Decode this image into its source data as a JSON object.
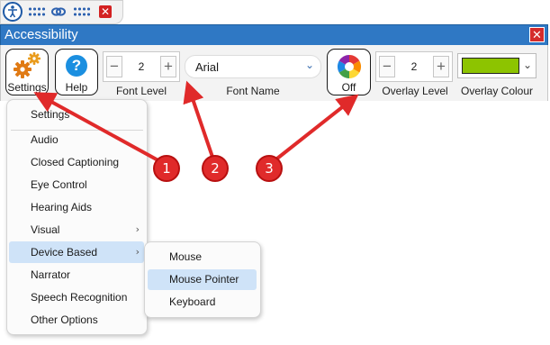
{
  "window": {
    "title": "Accessibility",
    "close_symbol": "✕"
  },
  "topbar": {
    "close_symbol": "✕"
  },
  "toolbar": {
    "settings_label": "Settings",
    "help_label": "Help",
    "help_symbol": "?",
    "font_level": {
      "label": "Font Level",
      "value": "2",
      "minus": "−",
      "plus": "+"
    },
    "font_name": {
      "label": "Font Name",
      "value": "Arial"
    },
    "overlay_toggle_label": "Off",
    "overlay_level": {
      "label": "Overlay Level",
      "value": "2",
      "minus": "−",
      "plus": "+"
    },
    "overlay_colour": {
      "label": "Overlay Colour",
      "color": "#8dc400"
    }
  },
  "settings_menu": {
    "items": [
      {
        "label": "Settings"
      },
      {
        "label": "Audio"
      },
      {
        "label": "Closed Captioning"
      },
      {
        "label": "Eye Control"
      },
      {
        "label": "Hearing Aids"
      },
      {
        "label": "Visual",
        "has_submenu": true
      },
      {
        "label": "Device Based",
        "has_submenu": true,
        "selected": true
      },
      {
        "label": "Narrator"
      },
      {
        "label": "Speech Recognition"
      },
      {
        "label": "Other Options"
      }
    ],
    "submenu_arrow": "›"
  },
  "device_submenu": {
    "items": [
      {
        "label": "Mouse"
      },
      {
        "label": "Mouse Pointer",
        "selected": true
      },
      {
        "label": "Keyboard"
      }
    ]
  },
  "annotations": {
    "color": "#e02a2a",
    "badges": [
      "1",
      "2",
      "3"
    ]
  }
}
